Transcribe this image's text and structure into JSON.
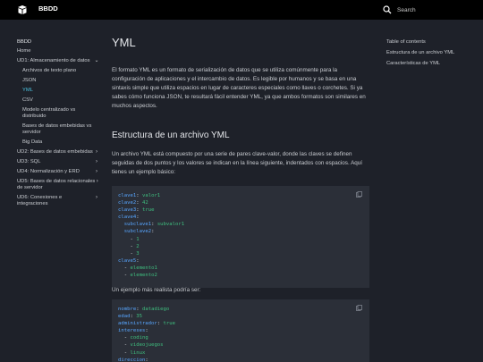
{
  "header": {
    "title": "BBDD",
    "search_placeholder": "Search"
  },
  "sidebar": {
    "title": "BBDD",
    "items": [
      {
        "label": "Home",
        "level": 0,
        "chevron": ""
      },
      {
        "label": "UD1: Almacenamiento de datos",
        "level": 0,
        "chevron": "⌄"
      },
      {
        "label": "Archivos de texto plano",
        "level": 1,
        "chevron": ""
      },
      {
        "label": "JSON",
        "level": 1,
        "chevron": ""
      },
      {
        "label": "YML",
        "level": 1,
        "chevron": "",
        "active": true
      },
      {
        "label": "CSV",
        "level": 1,
        "chevron": ""
      },
      {
        "label": "Modelo centralizado vs distribuido",
        "level": 1,
        "chevron": ""
      },
      {
        "label": "Bases de datos embebidas vs servidor",
        "level": 1,
        "chevron": ""
      },
      {
        "label": "Big Data",
        "level": 1,
        "chevron": ""
      },
      {
        "label": "UD2: Bases de datos embebidas",
        "level": 0,
        "chevron": "›"
      },
      {
        "label": "UD3: SQL",
        "level": 0,
        "chevron": "›"
      },
      {
        "label": "UD4: Normalización y ERD",
        "level": 0,
        "chevron": "›"
      },
      {
        "label": "UD5: Bases de datos relacionales de servidor",
        "level": 0,
        "chevron": "›"
      },
      {
        "label": "UD6: Conexiones e integraciones",
        "level": 0,
        "chevron": "›"
      }
    ]
  },
  "main": {
    "title": "YML",
    "intro": "El formato YML es un formato de serialización de datos que se utiliza comúnmente para la configuración de aplicaciones y el intercambio de datos. Es legible por humanos y se basa en una sintaxis simple que utiliza espacios en lugar de caracteres especiales como llaves o corchetes. Si ya sabes cómo funciona JSON, te resultará fácil entender YML, ya que ambos formatos son similares en muchos aspectos.",
    "section_title": "Estructura de un archivo YML",
    "section_text": "Un archivo YML está compuesto por una serie de pares clave-valor, donde las claves se definen seguidas de dos puntos y los valores se indican en la línea siguiente, indentados con espacios. Aquí tienes un ejemplo básico:",
    "example2_intro": "Un ejemplo más realista podría ser:",
    "code1": [
      {
        "indent": "",
        "key": "clave1",
        "sep": ": ",
        "value": "valor1"
      },
      {
        "indent": "",
        "key": "clave2",
        "sep": ": ",
        "value": "42"
      },
      {
        "indent": "",
        "key": "clave3",
        "sep": ": ",
        "value": "true"
      },
      {
        "indent": "",
        "key": "clave4",
        "sep": ":",
        "value": ""
      },
      {
        "indent": "  ",
        "key": "subclave1",
        "sep": ": ",
        "value": "subvalor1"
      },
      {
        "indent": "  ",
        "key": "subclave2",
        "sep": ":",
        "value": ""
      },
      {
        "indent": "    ",
        "key": "- ",
        "sep": "",
        "value": "1"
      },
      {
        "indent": "    ",
        "key": "- ",
        "sep": "",
        "value": "2"
      },
      {
        "indent": "    ",
        "key": "- ",
        "sep": "",
        "value": "3"
      },
      {
        "indent": "",
        "key": "clave5",
        "sep": ":",
        "value": ""
      },
      {
        "indent": "  ",
        "key": "- ",
        "sep": "",
        "value": "elemento1"
      },
      {
        "indent": "  ",
        "key": "- ",
        "sep": "",
        "value": "elemento2"
      }
    ],
    "code2": [
      {
        "indent": "",
        "key": "nombre",
        "sep": ": ",
        "value": "datadiego"
      },
      {
        "indent": "",
        "key": "edad",
        "sep": ": ",
        "value": "35"
      },
      {
        "indent": "",
        "key": "administrador",
        "sep": ": ",
        "value": "true"
      },
      {
        "indent": "",
        "key": "intereses",
        "sep": ":",
        "value": ""
      },
      {
        "indent": "  ",
        "key": "- ",
        "sep": "",
        "value": "coding"
      },
      {
        "indent": "  ",
        "key": "- ",
        "sep": "",
        "value": "videojuegos"
      },
      {
        "indent": "  ",
        "key": "- ",
        "sep": "",
        "value": "linux"
      },
      {
        "indent": "",
        "key": "direccion",
        "sep": ":",
        "value": ""
      }
    ]
  },
  "toc": {
    "title": "Table of contents",
    "items": [
      "Estructura de un archivo YML",
      "Características de YML"
    ]
  }
}
